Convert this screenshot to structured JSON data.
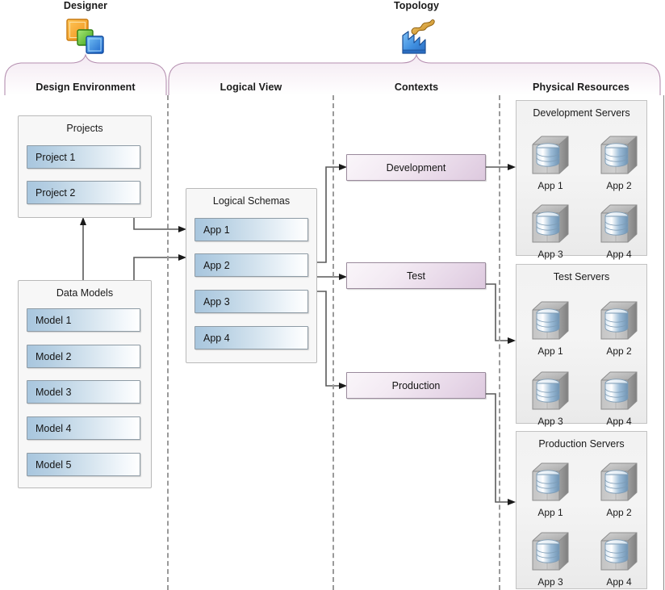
{
  "groups": [
    {
      "label": "Designer",
      "icon": "stacked-squares-icon"
    },
    {
      "label": "Topology",
      "icon": "factory-icon"
    }
  ],
  "columns": [
    {
      "label": "Design Environment"
    },
    {
      "label": "Logical View"
    },
    {
      "label": "Contexts"
    },
    {
      "label": "Physical Resources"
    }
  ],
  "design_environment": {
    "projects_panel": {
      "title": "Projects",
      "items": [
        "Project 1",
        "Project 2"
      ]
    },
    "data_models_panel": {
      "title": "Data Models",
      "items": [
        "Model 1",
        "Model 2",
        "Model 3",
        "Model 4",
        "Model 5"
      ]
    }
  },
  "logical_view": {
    "panel": {
      "title": "Logical Schemas",
      "items": [
        "App 1",
        "App 2",
        "App 3",
        "App 4"
      ]
    }
  },
  "contexts": {
    "boxes": [
      "Development",
      "Test",
      "Production"
    ]
  },
  "physical_resources": {
    "panels": [
      {
        "title": "Development Servers",
        "servers": [
          "App 1",
          "App 2",
          "App 3",
          "App 4"
        ]
      },
      {
        "title": "Test Servers",
        "servers": [
          "App 1",
          "App 2",
          "App 3",
          "App 4"
        ]
      },
      {
        "title": "Production Servers",
        "servers": [
          "App 1",
          "App 2",
          "App 3",
          "App 4"
        ]
      }
    ]
  },
  "colors": {
    "banner_fill": "#f7f0f6",
    "banner_stroke": "#b58fb0",
    "item_blue": "#a8c6de",
    "context_mauve": "#ddc9de",
    "panel_bg": "#f7f7f7",
    "divider": "#9a9a9a",
    "connector": "#5a5a5a"
  }
}
